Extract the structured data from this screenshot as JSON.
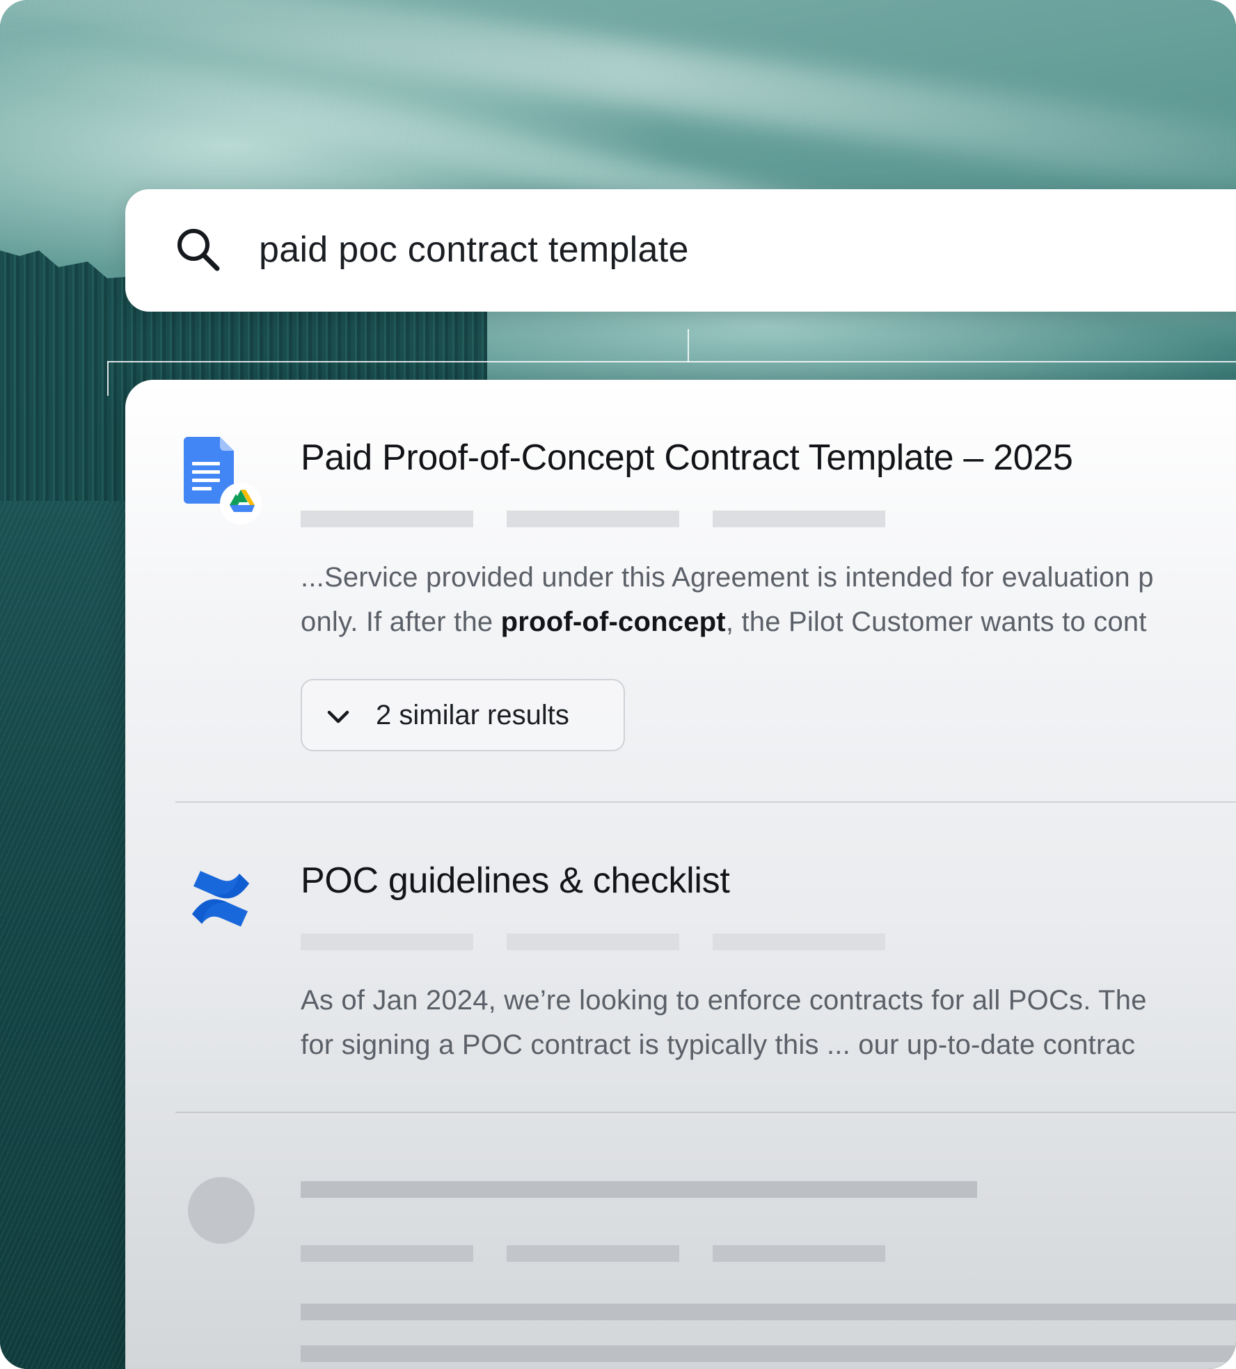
{
  "search": {
    "query": "paid poc contract template"
  },
  "results": [
    {
      "title": "Paid Proof-of-Concept Contract Template – 2025",
      "icon": "google-docs-icon",
      "source_icon": "google-drive-icon",
      "snippet_line1": "...Service provided under this Agreement is intended for evaluation p",
      "snippet_line2_before": "only. If after the ",
      "snippet_line2_bold": "proof-of-concept",
      "snippet_line2_after": ", the Pilot Customer wants to cont",
      "similar_label": "2 similar results"
    },
    {
      "title": "POC guidelines & checklist",
      "icon": "confluence-icon",
      "snippet_line1": "As of Jan 2024, we’re looking to enforce contracts for all POCs. The",
      "snippet_line2": "for signing a POC contract is typically this ... our up-to-date contrac"
    }
  ],
  "colors": {
    "docs_blue": "#4285F4",
    "confluence_blue": "#1868DB",
    "drive_green": "#0F9D58",
    "drive_yellow": "#FBBC04",
    "drive_blue": "#4285F4"
  }
}
